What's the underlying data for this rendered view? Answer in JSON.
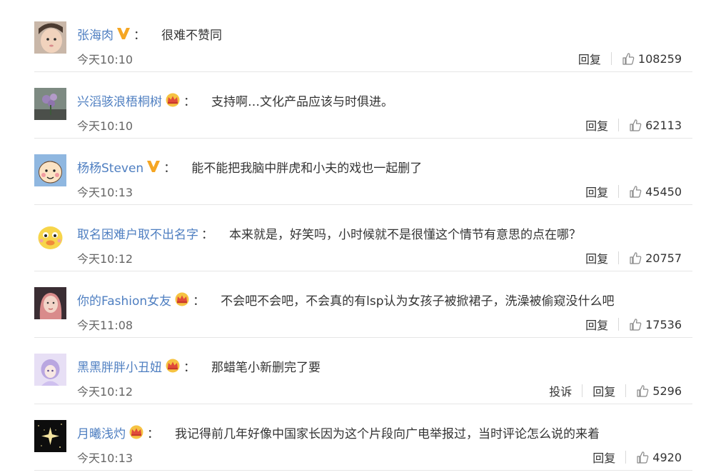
{
  "colors": {
    "username": "#4f7fc1",
    "text": "#333333",
    "time": "#666666",
    "separator": "#e6e6e6",
    "vip_badge": "#f5a623",
    "crown_badge": "#f4a92a"
  },
  "comments": [
    {
      "user": "张海肉",
      "badge": "vip-v-icon",
      "colon": "：",
      "text": "很难不赞同",
      "time": "今天10:10",
      "report": "",
      "reply": "回复",
      "likes": "108259",
      "avatar": "child-photo-avatar"
    },
    {
      "user": "兴滔骇浪梧桐树",
      "badge": "crown-icon",
      "colon": "：",
      "text": "支持啊…文化产品应该与时俱进。",
      "time": "今天10:10",
      "report": "",
      "reply": "回复",
      "likes": "62113",
      "avatar": "flower-photo-avatar"
    },
    {
      "user": "杨杨Steven",
      "badge": "vip-v-icon",
      "colon": "：",
      "text": "能不能把我脑中胖虎和小夫的戏也一起删了",
      "time": "今天10:13",
      "report": "",
      "reply": "回复",
      "likes": "45450",
      "avatar": "cartoon-boy-avatar"
    },
    {
      "user": "取名困难户取不出名字",
      "badge": "",
      "colon": "：",
      "text": "本来就是，好笑吗，小时候就不是很懂这个情节有意思的点在哪？",
      "time": "今天10:12",
      "report": "",
      "reply": "回复",
      "likes": "20757",
      "avatar": "yellow-duck-avatar"
    },
    {
      "user": "你的Fashion女友",
      "badge": "crown-icon",
      "colon": "：",
      "text": "不会吧不会吧，不会真的有lsp认为女孩子被掀裙子，洗澡被偷窥没什么吧",
      "time": "今天11:08",
      "report": "",
      "reply": "回复",
      "likes": "17536",
      "avatar": "girl-pink-hair-avatar"
    },
    {
      "user": "黑黑胖胖小丑妞",
      "badge": "crown-icon",
      "colon": "：",
      "text": "那蜡笔小新删完了要",
      "time": "今天10:12",
      "report": "投诉",
      "reply": "回复",
      "likes": "5296",
      "avatar": "anime-girl-avatar"
    },
    {
      "user": "月曦浅灼",
      "badge": "crown-icon",
      "colon": "：",
      "text": "我记得前几年好像中国家长因为这个片段向广电举报过，当时评论怎么说的来着",
      "time": "今天10:13",
      "report": "",
      "reply": "回复",
      "likes": "4920",
      "avatar": "night-star-avatar"
    }
  ]
}
